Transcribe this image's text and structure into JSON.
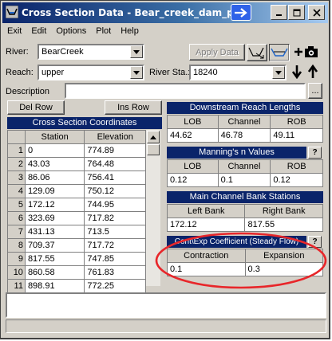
{
  "window": {
    "title": "Cross Section Data - Bear_creek_dam_pm"
  },
  "menu": {
    "exit": "Exit",
    "edit": "Edit",
    "options": "Options",
    "plot": "Plot",
    "help": "Help"
  },
  "river": {
    "label": "River:",
    "value": "BearCreek"
  },
  "reach": {
    "label": "Reach:",
    "value": "upper"
  },
  "river_sta": {
    "label": "River Sta.:",
    "value": "18240"
  },
  "apply_data": "Apply Data",
  "description": {
    "label": "Description",
    "ellipsis": "..."
  },
  "del_row": "Del Row",
  "ins_row": "Ins Row",
  "xs_coords": {
    "title": "Cross Section Coordinates",
    "headers": [
      "Station",
      "Elevation"
    ],
    "rows": [
      {
        "n": "1",
        "station": "0",
        "elevation": "774.89"
      },
      {
        "n": "2",
        "station": "43.03",
        "elevation": "764.48"
      },
      {
        "n": "3",
        "station": "86.06",
        "elevation": "756.41"
      },
      {
        "n": "4",
        "station": "129.09",
        "elevation": "750.12"
      },
      {
        "n": "5",
        "station": "172.12",
        "elevation": "744.95"
      },
      {
        "n": "6",
        "station": "323.69",
        "elevation": "717.82"
      },
      {
        "n": "7",
        "station": "431.13",
        "elevation": "713.5"
      },
      {
        "n": "8",
        "station": "709.37",
        "elevation": "717.72"
      },
      {
        "n": "9",
        "station": "817.55",
        "elevation": "747.85"
      },
      {
        "n": "10",
        "station": "860.58",
        "elevation": "761.83"
      },
      {
        "n": "11",
        "station": "898.91",
        "elevation": "772.25"
      }
    ]
  },
  "downstream": {
    "title": "Downstream Reach Lengths",
    "headers": [
      "LOB",
      "Channel",
      "ROB"
    ],
    "values": [
      "44.62",
      "46.78",
      "49.11"
    ]
  },
  "mannings": {
    "title": "Manning's n Values",
    "help": "?",
    "headers": [
      "LOB",
      "Channel",
      "ROB"
    ],
    "values": [
      "0.12",
      "0.1",
      "0.12"
    ]
  },
  "bank_stations": {
    "title": "Main Channel Bank Stations",
    "headers": [
      "Left Bank",
      "Right Bank"
    ],
    "values": [
      "172.12",
      "817.55"
    ]
  },
  "cont_exp": {
    "title": "Cont\\Exp Coefficient (Steady Flow)",
    "help": "?",
    "headers": [
      "Contraction",
      "Expansion"
    ],
    "values": [
      "0.1",
      "0.3"
    ]
  },
  "colors": {
    "highlight_ellipse": "#e8262a",
    "header_blue": "#0a246a"
  }
}
